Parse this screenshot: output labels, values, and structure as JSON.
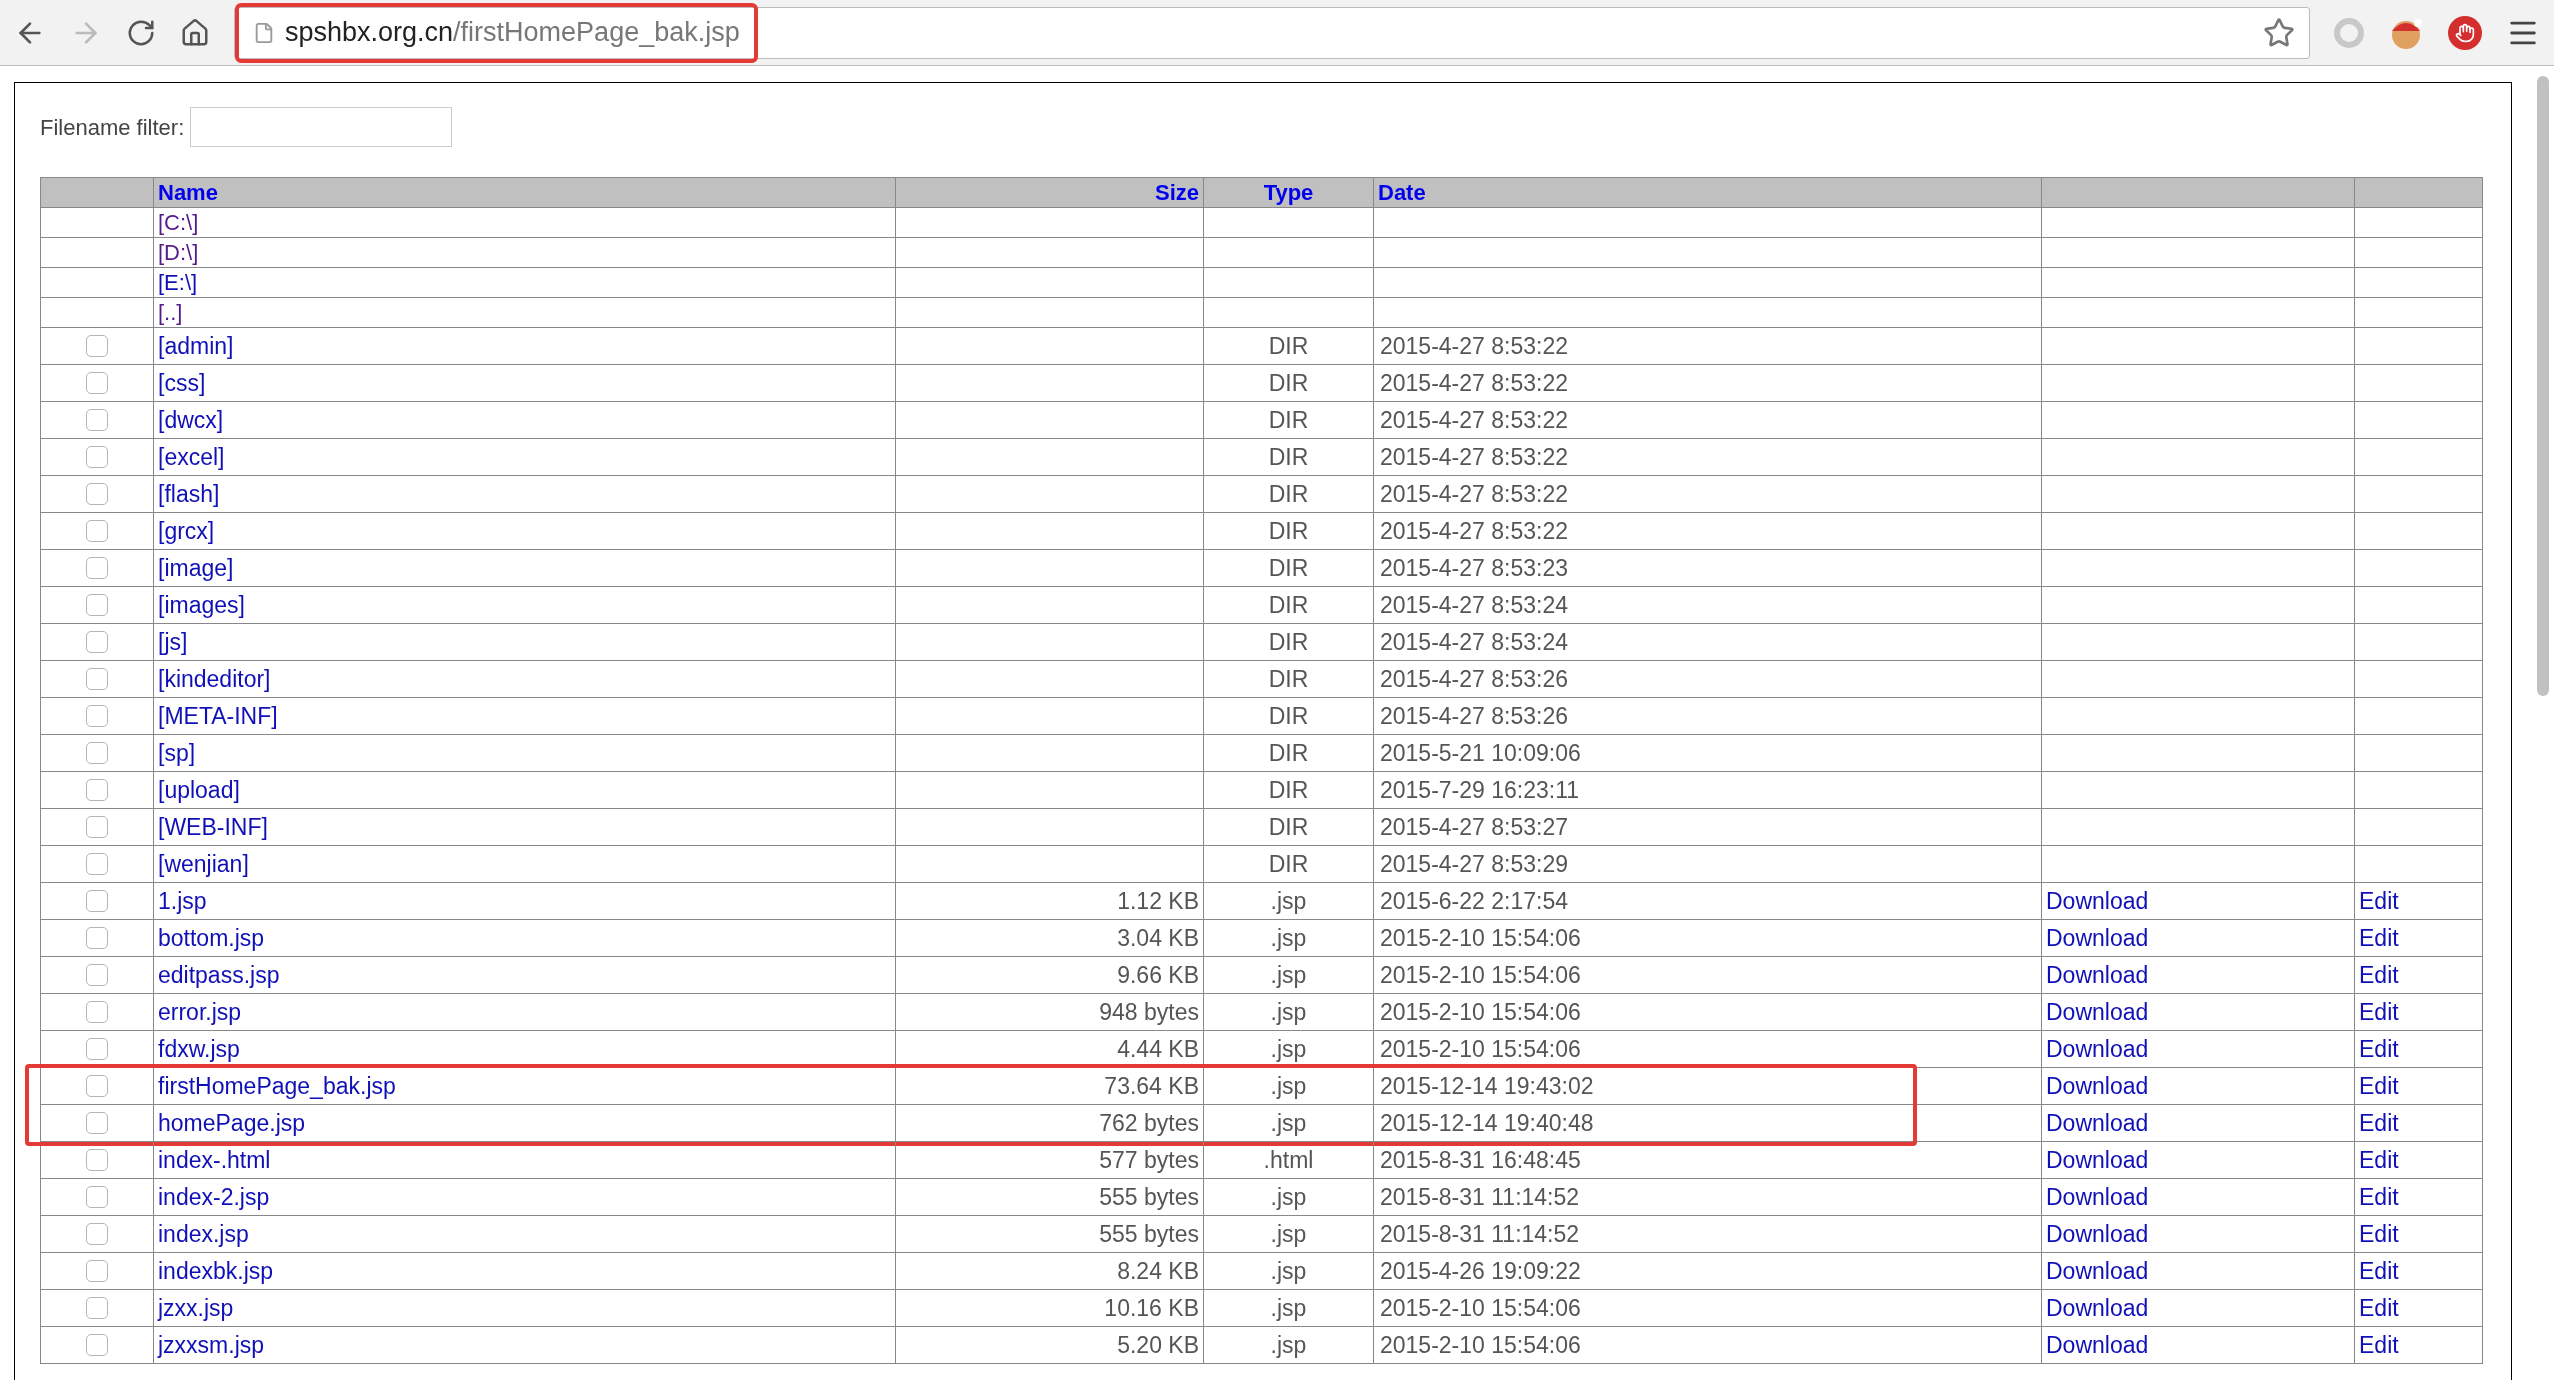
{
  "address_bar": {
    "host": "spshbx.org.cn",
    "path": "/firstHomePage_bak.jsp",
    "highlighted": true
  },
  "filter": {
    "label": "Filename filter:"
  },
  "columns": [
    {
      "label": "Name"
    },
    {
      "label": "Size"
    },
    {
      "label": "Type"
    },
    {
      "label": "Date"
    }
  ],
  "drives": [
    {
      "name": "[C:\\]",
      "visited": true
    },
    {
      "name": "[D:\\]",
      "visited": true
    },
    {
      "name": "[E:\\]",
      "visited": false
    },
    {
      "name": "[..]",
      "visited": true
    }
  ],
  "rows": [
    {
      "name": "[admin]",
      "type": "DIR",
      "date": "2015-4-27 8:53:22",
      "checked": false,
      "highlighted": false
    },
    {
      "name": "[css]",
      "type": "DIR",
      "date": "2015-4-27 8:53:22",
      "checked": false,
      "highlighted": false
    },
    {
      "name": "[dwcx]",
      "type": "DIR",
      "date": "2015-4-27 8:53:22",
      "checked": false,
      "highlighted": false
    },
    {
      "name": "[excel]",
      "type": "DIR",
      "date": "2015-4-27 8:53:22",
      "checked": false,
      "highlighted": false
    },
    {
      "name": "[flash]",
      "type": "DIR",
      "date": "2015-4-27 8:53:22",
      "checked": false,
      "highlighted": false
    },
    {
      "name": "[grcx]",
      "type": "DIR",
      "date": "2015-4-27 8:53:22",
      "checked": false,
      "highlighted": false
    },
    {
      "name": "[image]",
      "type": "DIR",
      "date": "2015-4-27 8:53:23",
      "checked": false,
      "highlighted": false
    },
    {
      "name": "[images]",
      "type": "DIR",
      "date": "2015-4-27 8:53:24",
      "checked": false,
      "highlighted": false
    },
    {
      "name": "[js]",
      "type": "DIR",
      "date": "2015-4-27 8:53:24",
      "checked": false,
      "highlighted": false
    },
    {
      "name": "[kindeditor]",
      "type": "DIR",
      "date": "2015-4-27 8:53:26",
      "checked": false,
      "highlighted": false
    },
    {
      "name": "[META-INF]",
      "type": "DIR",
      "date": "2015-4-27 8:53:26",
      "checked": false,
      "highlighted": false
    },
    {
      "name": "[sp]",
      "type": "DIR",
      "date": "2015-5-21 10:09:06",
      "checked": false,
      "highlighted": false
    },
    {
      "name": "[upload]",
      "type": "DIR",
      "date": "2015-7-29 16:23:11",
      "checked": false,
      "highlighted": false
    },
    {
      "name": "[WEB-INF]",
      "type": "DIR",
      "date": "2015-4-27 8:53:27",
      "checked": false,
      "highlighted": false
    },
    {
      "name": "[wenjian]",
      "type": "DIR",
      "date": "2015-4-27 8:53:29",
      "checked": false,
      "highlighted": false
    },
    {
      "name": "1.jsp",
      "size": "1.12 KB",
      "type": ".jsp",
      "date": "2015-6-22 2:17:54",
      "download": "Download",
      "edit": "Edit",
      "checked": false,
      "highlighted": false
    },
    {
      "name": "bottom.jsp",
      "size": "3.04 KB",
      "type": ".jsp",
      "date": "2015-2-10 15:54:06",
      "download": "Download",
      "edit": "Edit",
      "checked": false,
      "highlighted": false
    },
    {
      "name": "editpass.jsp",
      "size": "9.66 KB",
      "type": ".jsp",
      "date": "2015-2-10 15:54:06",
      "download": "Download",
      "edit": "Edit",
      "checked": false,
      "highlighted": false
    },
    {
      "name": "error.jsp",
      "size": "948 bytes",
      "type": ".jsp",
      "date": "2015-2-10 15:54:06",
      "download": "Download",
      "edit": "Edit",
      "checked": false,
      "highlighted": false
    },
    {
      "name": "fdxw.jsp",
      "size": "4.44 KB",
      "type": ".jsp",
      "date": "2015-2-10 15:54:06",
      "download": "Download",
      "edit": "Edit",
      "checked": false,
      "highlighted": false
    },
    {
      "name": "firstHomePage_bak.jsp",
      "size": "73.64 KB",
      "type": ".jsp",
      "date": "2015-12-14 19:43:02",
      "download": "Download",
      "edit": "Edit",
      "checked": false,
      "highlighted": true
    },
    {
      "name": "homePage.jsp",
      "size": "762 bytes",
      "type": ".jsp",
      "date": "2015-12-14 19:40:48",
      "download": "Download",
      "edit": "Edit",
      "checked": false,
      "highlighted": true
    },
    {
      "name": "index-.html",
      "size": "577 bytes",
      "type": ".html",
      "date": "2015-8-31 16:48:45",
      "download": "Download",
      "edit": "Edit",
      "checked": false,
      "highlighted": false
    },
    {
      "name": "index-2.jsp",
      "size": "555 bytes",
      "type": ".jsp",
      "date": "2015-8-31 11:14:52",
      "download": "Download",
      "edit": "Edit",
      "checked": false,
      "highlighted": false
    },
    {
      "name": "index.jsp",
      "size": "555 bytes",
      "type": ".jsp",
      "date": "2015-8-31 11:14:52",
      "download": "Download",
      "edit": "Edit",
      "checked": false,
      "highlighted": false
    },
    {
      "name": "indexbk.jsp",
      "size": "8.24 KB",
      "type": ".jsp",
      "date": "2015-4-26 19:09:22",
      "download": "Download",
      "edit": "Edit",
      "checked": false,
      "highlighted": false
    },
    {
      "name": "jzxx.jsp",
      "size": "10.16 KB",
      "type": ".jsp",
      "date": "2015-2-10 15:54:06",
      "download": "Download",
      "edit": "Edit",
      "checked": false,
      "highlighted": false
    },
    {
      "name": "jzxxsm.jsp",
      "size": "5.20 KB",
      "type": ".jsp",
      "date": "2015-2-10 15:54:06",
      "download": "Download",
      "edit": "Edit",
      "checked": false,
      "highlighted": false
    }
  ]
}
